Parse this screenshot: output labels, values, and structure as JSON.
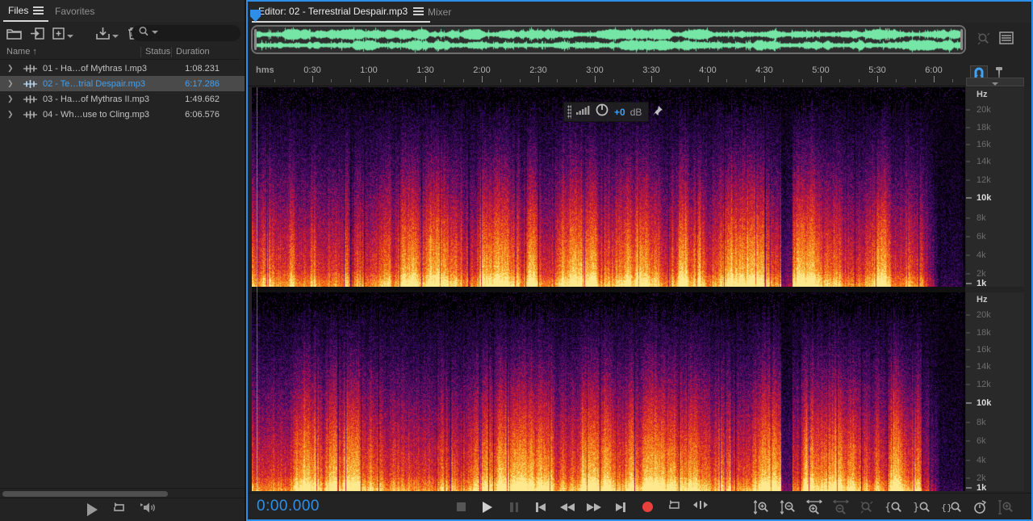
{
  "colors": {
    "accent_blue": "#2f8fe8",
    "selection_text": "#3fa2f4",
    "waveform_green": "#76e6a6",
    "record_red": "#e8413c",
    "spectro_palette": [
      "#000000",
      "#1a0530",
      "#3b0a6b",
      "#7a1060",
      "#b01545",
      "#d9262b",
      "#ef5a17",
      "#f68c1f",
      "#fbbf3a",
      "#ffe98f"
    ]
  },
  "files_panel": {
    "tab_files": "Files",
    "tab_favorites": "Favorites",
    "columns": {
      "name": "Name",
      "sort_arrow": "↑",
      "status": "Status",
      "duration": "Duration"
    },
    "rows": [
      {
        "name": "01 - Ha…of Mythras I.mp3",
        "duration": "1:08.231"
      },
      {
        "name": "02 - Te…trial Despair.mp3",
        "duration": "6:17.286"
      },
      {
        "name": "03 - Ha…of Mythras II.mp3",
        "duration": "1:49.662"
      },
      {
        "name": "04 - Wh…use to Cling.mp3",
        "duration": "6:06.576"
      }
    ]
  },
  "editor": {
    "tab_editor": "Editor: 02 - Terrestrial Despair.mp3",
    "tab_mixer": "Mixer",
    "ruler_unit": "hms",
    "ruler_ticks": [
      "0:30",
      "1:00",
      "1:30",
      "2:00",
      "2:30",
      "3:00",
      "3:30",
      "4:00",
      "4:30",
      "5:00",
      "5:30",
      "6:00"
    ],
    "hud": {
      "gain": "+0",
      "unit": "dB"
    },
    "freq_scale": {
      "unit": "Hz",
      "labels": [
        "20k",
        "18k",
        "16k",
        "14k",
        "12k",
        "10k",
        "8k",
        "6k",
        "4k",
        "2k",
        "1k"
      ],
      "bold": [
        "10k",
        "1k"
      ]
    },
    "time_display": "0:00.000"
  }
}
